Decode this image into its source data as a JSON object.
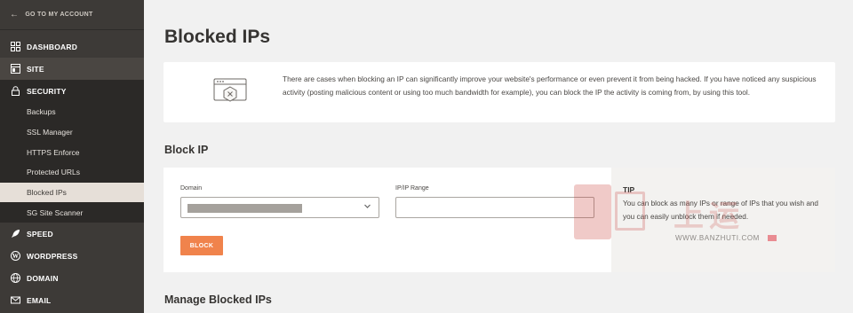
{
  "sidebar": {
    "back_label": "GO TO MY ACCOUNT",
    "sections": {
      "dashboard": "DASHBOARD",
      "site": "SITE",
      "security": "SECURITY",
      "speed": "SPEED",
      "wordpress": "WORDPRESS",
      "domain": "DOMAIN",
      "email": "EMAIL"
    },
    "security_items": [
      "Backups",
      "SSL Manager",
      "HTTPS Enforce",
      "Protected URLs",
      "Blocked IPs",
      "SG Site Scanner"
    ],
    "active_item": "Blocked IPs"
  },
  "main": {
    "title": "Blocked IPs",
    "info_text": "There are cases when blocking an IP can significantly improve your website's performance or even prevent it from being hacked. If you have noticed any suspicious activity (posting malicious content or using too much bandwidth for example), you can block the IP the activity is coming from, by using this tool.",
    "block_section": {
      "title": "Block IP",
      "domain_label": "Domain",
      "ip_label": "IP/IP Range",
      "ip_value": "",
      "button_label": "BLOCK",
      "tip_title": "TIP",
      "tip_text": "You can block as many IPs or range of IPs that you wish and you can easily unblock them if needed."
    },
    "manage_title": "Manage Blocked IPs"
  },
  "watermark": {
    "chars": "上运",
    "url": "WWW.BANZHUTI.COM"
  },
  "colors": {
    "sidebar_bg": "#3d3a37",
    "accent": "#f0834c",
    "active_item_bg": "#e6dfd8"
  }
}
